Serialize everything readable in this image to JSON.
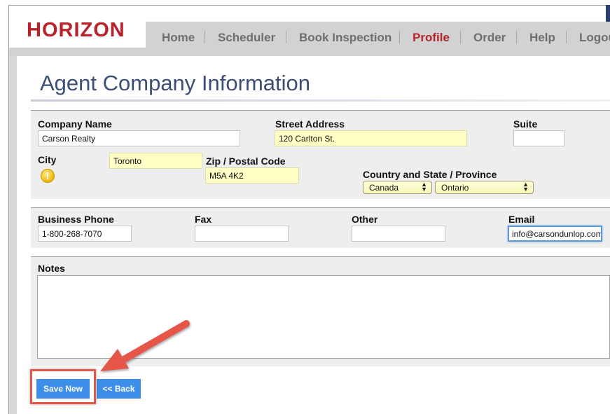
{
  "brand": {
    "logo_text": "HORIZON",
    "color": "#b8222a"
  },
  "nav": {
    "items": [
      {
        "label": "Home",
        "active": false
      },
      {
        "label": "Scheduler",
        "active": false
      },
      {
        "label": "Book Inspection",
        "active": false
      },
      {
        "label": "Profile",
        "active": true
      },
      {
        "label": "Order",
        "active": false
      },
      {
        "label": "Help",
        "active": false
      },
      {
        "label": "Logout",
        "active": false
      }
    ]
  },
  "page": {
    "title": "Agent Company Information"
  },
  "address": {
    "company_name": {
      "label": "Company Name",
      "value": "Carson Realty"
    },
    "street": {
      "label": "Street Address",
      "value": "120 Carlton St."
    },
    "suite": {
      "label": "Suite",
      "value": ""
    },
    "city": {
      "label": "City",
      "value": "Toronto",
      "warning_icon": "warning-icon"
    },
    "zip": {
      "label": "Zip / Postal Code",
      "value": "M5A 4K2"
    },
    "country_state": {
      "label": "Country and State / Province",
      "country": "Canada",
      "province": "Ontario"
    }
  },
  "contact": {
    "business_phone": {
      "label": "Business Phone",
      "value": "1-800-268-7070"
    },
    "fax": {
      "label": "Fax",
      "value": ""
    },
    "other": {
      "label": "Other",
      "value": ""
    },
    "email": {
      "label": "Email",
      "value": "info@carsondunlop.com"
    }
  },
  "notes": {
    "label": "Notes",
    "value": ""
  },
  "actions": {
    "save_label": "Save New",
    "back_label": "<< Back",
    "button_color": "#3d8ee8"
  },
  "annotation": {
    "highlight_color": "#e5574a"
  }
}
